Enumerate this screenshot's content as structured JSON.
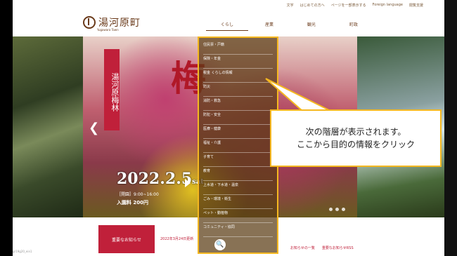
{
  "util_links": [
    "文字",
    "はじめての方へ",
    "ページを一部表示する",
    "Foreign language",
    "閲覧支援"
  ],
  "logo": {
    "text": "湯河原町",
    "sub": "Yugawara Town"
  },
  "nav": [
    "くらし",
    "産業",
    "観光",
    "町政"
  ],
  "hero": {
    "banner": "湯河原梅林",
    "big_char": "梅",
    "date": "2022.2.5",
    "date_day": "sat",
    "hours": "［開園］9:00~16:00",
    "fee": "入園料 200円"
  },
  "dropdown_items": [
    "住民票・戸籍",
    "保険・年金",
    "税金 くらしの情報",
    "防災",
    "消防・救急",
    "防犯・安全",
    "医療・健康",
    "福祉・介護",
    "子育て",
    "教育",
    "上水道・下水道・温泉",
    "ごみ・環境・衛生",
    "ペット・動植物",
    "コミュニティ・協同"
  ],
  "callout": {
    "line1": "次の階層が表示されます。",
    "line2": "ここから目的の情報をクリック"
  },
  "notice": {
    "label": "重要なお知らせ",
    "date": "2022年3月24日更新",
    "link1": "お知らせの一覧",
    "link2": "重要なお知らせRSS"
  },
  "status": "gr19g20_ein1"
}
